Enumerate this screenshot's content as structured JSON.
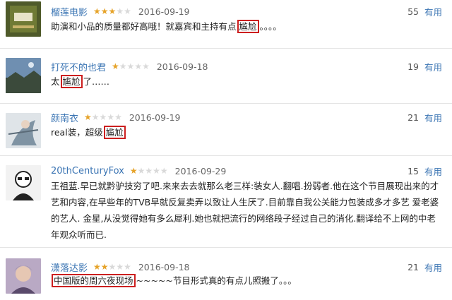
{
  "reviews": [
    {
      "user": "榴莲电影",
      "stars_full": 3,
      "stars_total": 5,
      "date": "2016-09-19",
      "votes": "55",
      "useful": "有用",
      "pre": "助演和小品的质量都好高哦！就嘉宾和主持有点",
      "hl": "尴尬",
      "post": "。。。。"
    },
    {
      "user": "打死不的也君",
      "stars_full": 1,
      "stars_total": 5,
      "date": "2016-09-18",
      "votes": "19",
      "useful": "有用",
      "pre": "太",
      "hl": "尴尬",
      "post": "了……"
    },
    {
      "user": "颜南衣",
      "stars_full": 1,
      "stars_total": 5,
      "date": "2016-09-19",
      "votes": "21",
      "useful": "有用",
      "pre": "real装，超级",
      "hl": "尴尬",
      "post": ""
    },
    {
      "user": "20thCenturyFox",
      "stars_full": 1,
      "stars_total": 5,
      "date": "2016-09-29",
      "votes": "15",
      "useful": "有用",
      "lines": [
        "王祖蓝.早已就黔驴技穷了吧.来来去去就那么老三样:装女人.翻唱.扮弱者.他在这个节目展现出来的才",
        "艺和内容,在早些年的TVB早就反复卖弄以致让人生厌了.目前靠自我公关能力包装成多才多艺 爱老婆",
        "的艺人. 金星,从没觉得她有多么犀利.她也就把流行的网络段子经过自己的消化.翻译给不上网的中老",
        "年观众听而已."
      ]
    },
    {
      "user": "潇落达影",
      "stars_full": 2,
      "stars_total": 5,
      "date": "2016-09-18",
      "votes": "21",
      "useful": "有用",
      "pre": "",
      "hl": "中国版的周六夜现场",
      "post": "~~~~~节目形式真的有点儿照搬了。。。"
    }
  ],
  "icons": {
    "star_full": "★",
    "star_empty": "★"
  },
  "colors": {
    "username": "#3a74b3",
    "star": "#e6a329",
    "highlight_border": "#cc1f1f"
  }
}
